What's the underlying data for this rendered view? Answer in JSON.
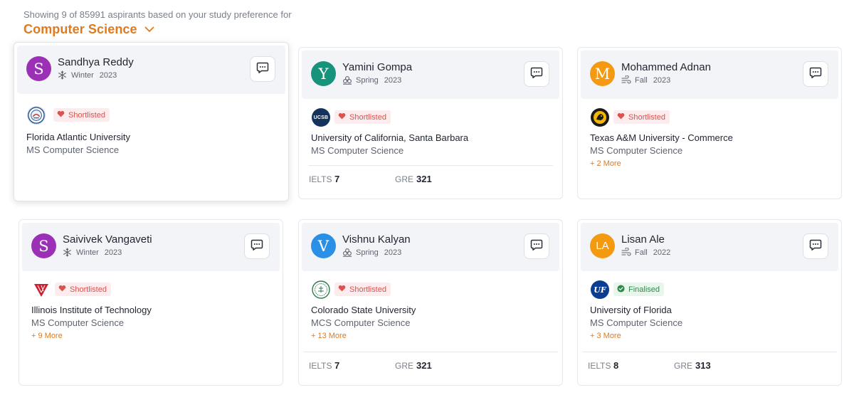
{
  "summary": "Showing 9 of 85991 aspirants based on your study preference for",
  "preference": "Computer Science",
  "colors": {
    "accent": "#e07a1f",
    "shortlisted": "#d9534f",
    "finalised": "#2e8b4a"
  },
  "cards": [
    {
      "name": "Sandhya Reddy",
      "initial": "S",
      "avatar_color": "#9b2fb5",
      "season_icon": "snowflake-icon",
      "season": "Winter",
      "year": "2023",
      "badge": "Shortlisted",
      "university": "Florida Atlantic University",
      "program": "MS Computer Science",
      "more": ""
    },
    {
      "name": "Yamini Gompa",
      "initial": "Y",
      "avatar_color": "#16937a",
      "season_icon": "flower-icon",
      "season": "Spring",
      "year": "2023",
      "badge": "Shortlisted",
      "university": "University of California, Santa Barbara",
      "program": "MS Computer Science",
      "more": "",
      "scores": [
        {
          "label": "IELTS",
          "value": "7"
        },
        {
          "label": "GRE",
          "value": "321"
        }
      ]
    },
    {
      "name": "Mohammed Adnan",
      "initial": "M",
      "avatar_color": "#f39a10",
      "season_icon": "wind-icon",
      "season": "Fall",
      "year": "2023",
      "badge": "Shortlisted",
      "university": "Texas A&M University - Commerce",
      "program": "MS Computer Science",
      "more": "+ 2 More"
    },
    {
      "name": "Saivivek Vangaveti",
      "initial": "S",
      "avatar_color": "#9b2fb5",
      "season_icon": "snowflake-icon",
      "season": "Winter",
      "year": "2023",
      "badge": "Shortlisted",
      "university": "Illinois Institute of Technology",
      "program": "MS Computer Science",
      "more": "+ 9 More"
    },
    {
      "name": "Vishnu Kalyan",
      "initial": "V",
      "avatar_color": "#2a90e6",
      "season_icon": "flower-icon",
      "season": "Spring",
      "year": "2023",
      "badge": "Shortlisted",
      "university": "Colorado State University",
      "program": "MCS Computer Science",
      "more": "+ 13 More",
      "scores": [
        {
          "label": "IELTS",
          "value": "7"
        },
        {
          "label": "GRE",
          "value": "321"
        }
      ]
    },
    {
      "name": "Lisan Ale",
      "initial": "LA",
      "avatar_color": "#f39a10",
      "season_icon": "wind-icon",
      "season": "Fall",
      "year": "2022",
      "badge": "Finalised",
      "university": "University of Florida",
      "program": "MS Computer Science",
      "more": "+ 3 More",
      "scores": [
        {
          "label": "IELTS",
          "value": "8"
        },
        {
          "label": "GRE",
          "value": "313"
        }
      ]
    }
  ],
  "logos": {
    "ucsb": "UCSB",
    "uf": "UF"
  }
}
